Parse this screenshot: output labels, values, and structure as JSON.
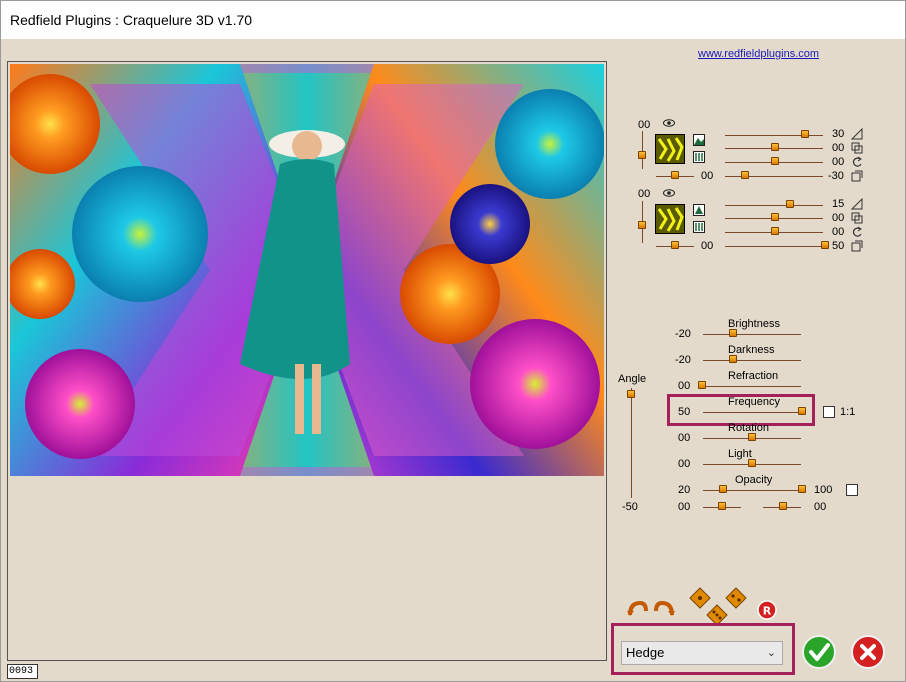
{
  "window": {
    "title": "Redfield Plugins : Craquelure 3D  v1.70"
  },
  "link": {
    "text": "www.redfieldplugins.com"
  },
  "preview": {
    "frame_counter": "0093"
  },
  "layer1": {
    "left_value": "00",
    "bottom_value": "00",
    "rows": [
      {
        "value": "30",
        "fraction": 0.78
      },
      {
        "value": "00",
        "fraction": 0.5
      },
      {
        "value": "00",
        "fraction": 0.5
      },
      {
        "value": "-30",
        "fraction": 0.22
      }
    ]
  },
  "layer2": {
    "left_value": "00",
    "bottom_value": "00",
    "rows": [
      {
        "value": "15",
        "fraction": 0.64
      },
      {
        "value": "00",
        "fraction": 0.5
      },
      {
        "value": "00",
        "fraction": 0.5
      },
      {
        "value": "50",
        "fraction": 1.0
      }
    ]
  },
  "angle": {
    "label": "Angle",
    "value": "-50"
  },
  "sliders": [
    {
      "label": "Brightness",
      "value": "-20",
      "fraction": 0.3
    },
    {
      "label": "Darkness",
      "value": "-20",
      "fraction": 0.3
    },
    {
      "label": "Refraction",
      "value": "00",
      "fraction": 0.0
    },
    {
      "label": "Frequency",
      "value": "50",
      "fraction": 1.0
    },
    {
      "label": "Rotation",
      "value": "00",
      "fraction": 0.5
    },
    {
      "label": "Light",
      "value": "00",
      "fraction": 0.5
    }
  ],
  "ratio": {
    "label": "1:1"
  },
  "opacity": {
    "label": "Opacity",
    "min_value": "20",
    "max_value": "100",
    "bottom_left": "00",
    "bottom_right": "00"
  },
  "preset": {
    "selected": "Hedge"
  },
  "colors": {
    "highlight": "#a3205a",
    "thumb": "#e08a00",
    "ok": "#2aa52a",
    "cancel": "#d42020"
  }
}
